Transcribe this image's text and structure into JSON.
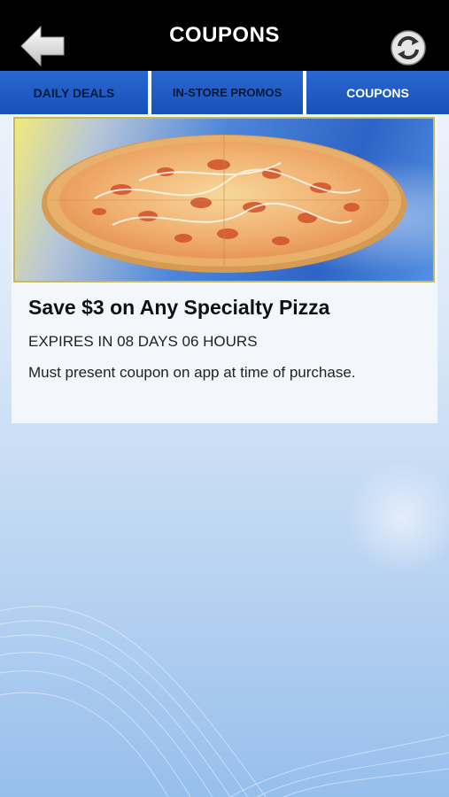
{
  "header": {
    "title": "COUPONS",
    "back_icon": "back-arrow-icon",
    "refresh_icon": "refresh-icon"
  },
  "tabs": [
    {
      "label": "DAILY DEALS",
      "active": false
    },
    {
      "label": "IN-STORE PROMOS",
      "active": false
    },
    {
      "label": "COUPONS",
      "active": true
    }
  ],
  "coupons": [
    {
      "image": "pizza-image",
      "title": "Save $3 on Any Specialty Pizza",
      "expiry": "EXPIRES IN 08 DAYS 06 HOURS",
      "description": "Must present coupon on app at time of purchase."
    }
  ],
  "colors": {
    "header_bg": "#000000",
    "tab_bg": "#1c58c0",
    "active_tab_text": "#ffffff",
    "inactive_tab_text": "#061a3c"
  }
}
